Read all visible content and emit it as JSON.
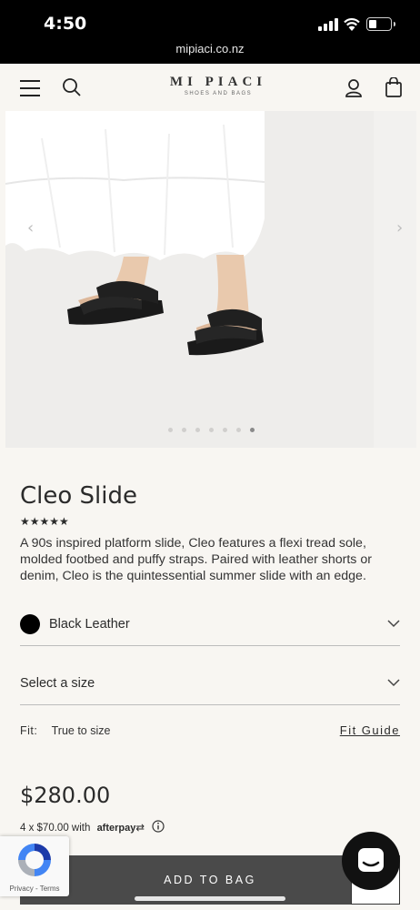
{
  "status_bar": {
    "time": "4:50",
    "url": "mipiaci.co.nz"
  },
  "header": {
    "brand": "MI PIACI",
    "brand_tagline": "SHOES AND BAGS"
  },
  "gallery": {
    "slide_count": 7,
    "active_slide": 7,
    "prev_arrow": "‹",
    "next_arrow": "›"
  },
  "product": {
    "title": "Cleo Slide",
    "rating_stars": "★★★★★",
    "rating": 5,
    "description": "A 90s inspired platform slide, Cleo features a flexi tread sole, molded footbed and puffy straps. Paired with leather shorts or denim, Cleo is the quintessential summer slide with an edge.",
    "color_option": "Black Leather",
    "color_swatch": "#000000",
    "size_placeholder": "Select a size",
    "fit_label": "Fit:",
    "fit_value": "True to size",
    "fit_guide": "Fit Guide",
    "price": "$280.00",
    "afterpay_text": "4 x $70.00 with",
    "afterpay_brand": "afterpay",
    "add_to_bag": "ADD TO BAG"
  },
  "recaptcha": {
    "links": "Privacy - Terms"
  },
  "icons": [
    "hamburger-icon",
    "search-icon",
    "account-icon",
    "bag-icon",
    "chevron-down-icon",
    "info-icon",
    "chat-icon"
  ]
}
